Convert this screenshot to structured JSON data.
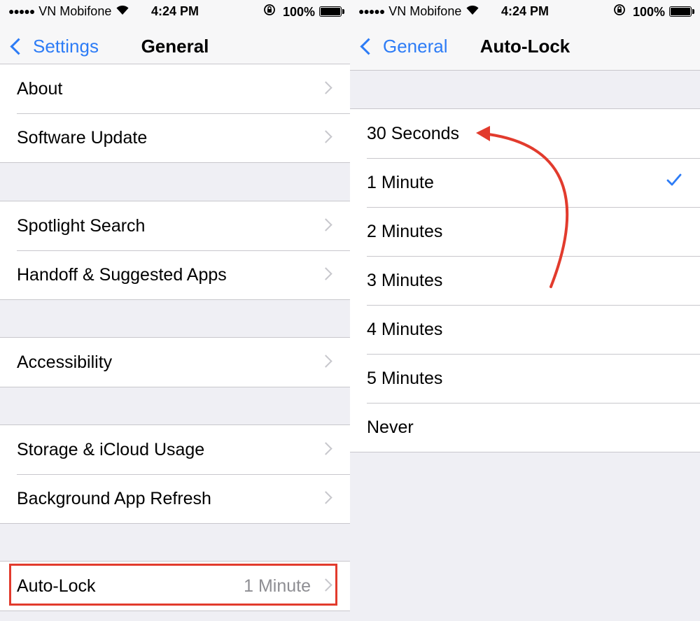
{
  "status_bar": {
    "signal": "●●●●●",
    "carrier": "VN Mobifone",
    "time": "4:24 PM",
    "battery": "100%",
    "icons": [
      "wifi-icon",
      "rotation-lock-icon",
      "battery-icon"
    ]
  },
  "left_screen": {
    "back_label": "Settings",
    "title": "General",
    "groups": [
      [
        {
          "label": "About"
        },
        {
          "label": "Software Update"
        }
      ],
      [
        {
          "label": "Spotlight Search"
        },
        {
          "label": "Handoff & Suggested Apps"
        }
      ],
      [
        {
          "label": "Accessibility"
        }
      ],
      [
        {
          "label": "Storage & iCloud Usage"
        },
        {
          "label": "Background App Refresh"
        }
      ],
      [
        {
          "label": "Auto-Lock",
          "value": "1 Minute"
        }
      ]
    ]
  },
  "right_screen": {
    "back_label": "General",
    "title": "Auto-Lock",
    "options": [
      {
        "label": "30 Seconds",
        "selected": false
      },
      {
        "label": "1 Minute",
        "selected": true
      },
      {
        "label": "2 Minutes",
        "selected": false
      },
      {
        "label": "3 Minutes",
        "selected": false
      },
      {
        "label": "4 Minutes",
        "selected": false
      },
      {
        "label": "5 Minutes",
        "selected": false
      },
      {
        "label": "Never",
        "selected": false
      }
    ]
  },
  "colors": {
    "accent": "#2d7cf6",
    "annotation": "#e23b2d",
    "background": "#efeff4",
    "secondary_text": "#8e8e93"
  }
}
